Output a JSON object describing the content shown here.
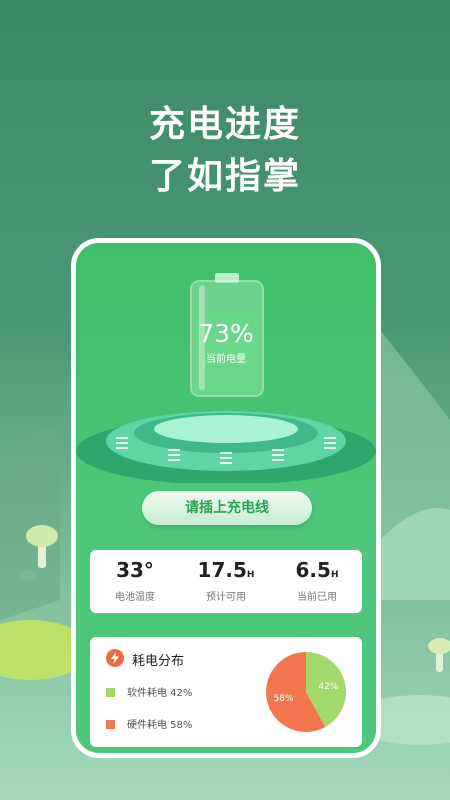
{
  "headline": {
    "line1": "充电进度",
    "line2": "了如指掌"
  },
  "battery": {
    "percent": "73%",
    "label": "当前电量"
  },
  "cta_label": "请插上充电线",
  "stats": [
    {
      "value": "33",
      "unit": "°",
      "label": "电池温度"
    },
    {
      "value": "17.5",
      "unit": "H",
      "label": "预计可用"
    },
    {
      "value": "6.5",
      "unit": "H",
      "label": "当前已用"
    }
  ],
  "distribution": {
    "title": "耗电分布",
    "items": [
      {
        "label": "软件耗电 42%",
        "pie_label": "42%",
        "value": 42,
        "color": "#a3d96a"
      },
      {
        "label": "硬件耗电 58%",
        "pie_label": "58%",
        "value": 58,
        "color": "#f2774f"
      }
    ]
  },
  "colors": {
    "primary": "#47c274",
    "accent": "#f06b43"
  },
  "icons": {
    "distribution": "lightning-icon"
  }
}
